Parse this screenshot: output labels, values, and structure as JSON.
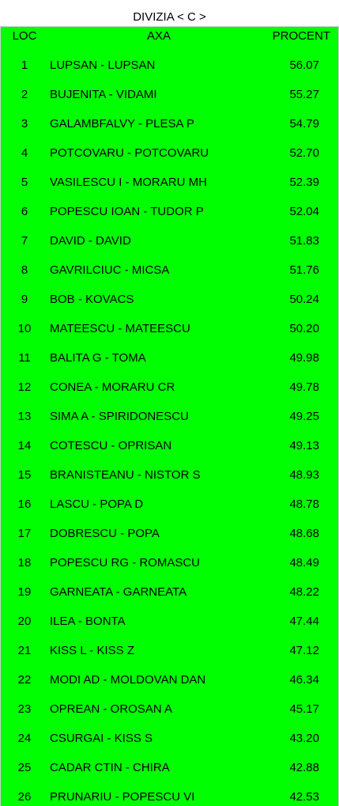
{
  "title": "DIVIZIA < C >",
  "colors": {
    "sheet_background": "#00ff00",
    "text": "#000000"
  },
  "table": {
    "headers": {
      "loc": "LOC",
      "axa": "AXA",
      "procent": "PROCENT"
    },
    "rows": [
      {
        "loc": "1",
        "axa": "LUPSAN - LUPSAN",
        "procent": "56.07"
      },
      {
        "loc": "2",
        "axa": "BUJENITA - VIDAMI",
        "procent": "55.27"
      },
      {
        "loc": "3",
        "axa": "GALAMBFALVY - PLESA P",
        "procent": "54.79"
      },
      {
        "loc": "4",
        "axa": "POTCOVARU - POTCOVARU",
        "procent": "52.70"
      },
      {
        "loc": "5",
        "axa": "VASILESCU I - MORARU MH",
        "procent": "52.39"
      },
      {
        "loc": "6",
        "axa": "POPESCU IOAN - TUDOR P",
        "procent": "52.04"
      },
      {
        "loc": "7",
        "axa": "DAVID - DAVID",
        "procent": "51.83"
      },
      {
        "loc": "8",
        "axa": "GAVRILCIUC - MICSA",
        "procent": "51.76"
      },
      {
        "loc": "9",
        "axa": "BOB - KOVACS",
        "procent": "50.24"
      },
      {
        "loc": "10",
        "axa": "MATEESCU - MATEESCU",
        "procent": "50.20"
      },
      {
        "loc": "11",
        "axa": "BALITA G - TOMA",
        "procent": "49.98"
      },
      {
        "loc": "12",
        "axa": "CONEA - MORARU CR",
        "procent": "49.78"
      },
      {
        "loc": "13",
        "axa": "SIMA A - SPIRIDONESCU",
        "procent": "49.25"
      },
      {
        "loc": "14",
        "axa": "COTESCU - OPRISAN",
        "procent": "49.13"
      },
      {
        "loc": "15",
        "axa": "BRANISTEANU - NISTOR S",
        "procent": "48.93"
      },
      {
        "loc": "16",
        "axa": "LASCU - POPA D",
        "procent": "48.78"
      },
      {
        "loc": "17",
        "axa": "DOBRESCU - POPA",
        "procent": "48.68"
      },
      {
        "loc": "18",
        "axa": "POPESCU RG - ROMASCU",
        "procent": "48.49"
      },
      {
        "loc": "19",
        "axa": "GARNEATA - GARNEATA",
        "procent": "48.22"
      },
      {
        "loc": "20",
        "axa": "ILEA - BONTA",
        "procent": "47.44"
      },
      {
        "loc": "21",
        "axa": "KISS L - KISS Z",
        "procent": "47.12"
      },
      {
        "loc": "22",
        "axa": "MODI AD - MOLDOVAN DAN",
        "procent": "46.34"
      },
      {
        "loc": "23",
        "axa": "OPREAN - OROSAN A",
        "procent": "45.17"
      },
      {
        "loc": "24",
        "axa": "CSURGAI - KISS S",
        "procent": "43.20"
      },
      {
        "loc": "25",
        "axa": "CADAR CTIN - CHIRA",
        "procent": "42.88"
      },
      {
        "loc": "26",
        "axa": "PRUNARIU - POPESCU VI",
        "procent": "42.53"
      }
    ]
  }
}
